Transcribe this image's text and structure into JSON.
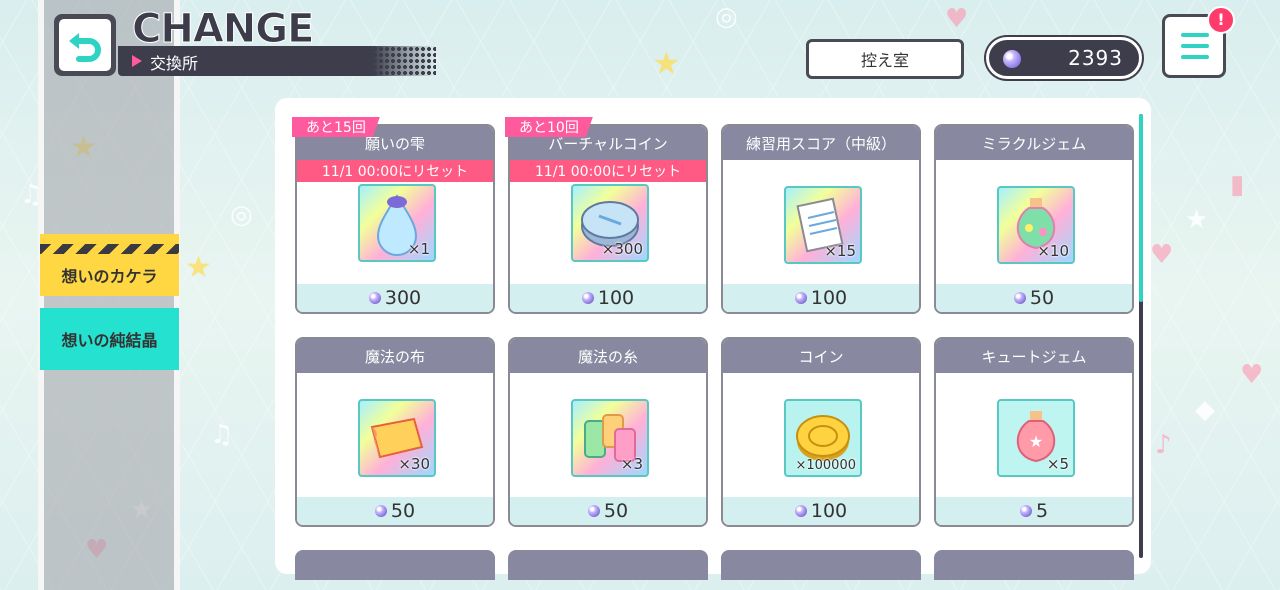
{
  "header": {
    "title": "CHANGE",
    "subtitle": "交換所",
    "waiting_room_label": "控え室",
    "gem_count": "2393",
    "notification_mark": "!"
  },
  "sidebar": {
    "items": [
      {
        "label": "想いのカケラ",
        "active": false
      },
      {
        "label": "想いの純結晶",
        "active": true
      }
    ]
  },
  "items": [
    {
      "name": "願いの雫",
      "limit": "あと15回",
      "reset": "11/1 00:00にリセット",
      "qty": "×1",
      "price": "300",
      "icon": "drop-icon"
    },
    {
      "name": "バーチャルコイン",
      "limit": "あと10回",
      "reset": "11/1 00:00にリセット",
      "qty": "×300",
      "price": "100",
      "icon": "virtual-coin-icon"
    },
    {
      "name": "練習用スコア（中級）",
      "qty": "×15",
      "price": "100",
      "icon": "score-sheet-icon"
    },
    {
      "name": "ミラクルジェム",
      "qty": "×10",
      "price": "50",
      "icon": "miracle-gem-icon"
    },
    {
      "name": "魔法の布",
      "qty": "×30",
      "price": "50",
      "icon": "cloth-icon"
    },
    {
      "name": "魔法の糸",
      "qty": "×3",
      "price": "50",
      "icon": "thread-icon"
    },
    {
      "name": "コイン",
      "qty": "×100000",
      "price": "100",
      "icon": "coin-icon"
    },
    {
      "name": "キュートジェム",
      "qty": "×5",
      "price": "5",
      "icon": "cute-gem-icon"
    }
  ],
  "colors": {
    "accent_teal": "#2ed3c4",
    "accent_pink": "#ff5a83",
    "header_dark": "#3d3d4c",
    "tab_yellow": "#ffd743"
  }
}
